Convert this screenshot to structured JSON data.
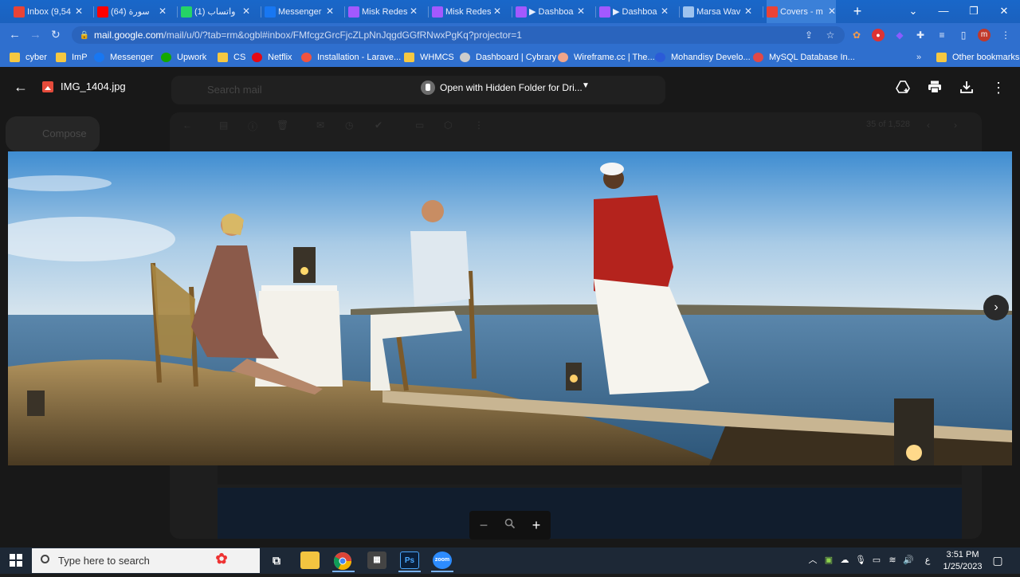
{
  "browser": {
    "tabs": [
      {
        "title": "Inbox (9,54",
        "icon": "gmail-icon",
        "color": "#ea4335"
      },
      {
        "title": "سورة (64)",
        "icon": "youtube-icon",
        "color": "#ff0000"
      },
      {
        "title": "(1) واتساب",
        "icon": "whatsapp-icon",
        "color": "#25d366"
      },
      {
        "title": "Messenger",
        "icon": "facebook-icon",
        "color": "#1877f2"
      },
      {
        "title": "Misk Redes",
        "icon": "figma-icon",
        "color": "#a259ff"
      },
      {
        "title": "Misk Redes",
        "icon": "figma-icon",
        "color": "#a259ff"
      },
      {
        "title": "▶ Dashboa",
        "icon": "figma-icon",
        "color": "#a259ff"
      },
      {
        "title": "▶ Dashboa",
        "icon": "figma-icon",
        "color": "#a259ff"
      },
      {
        "title": "Marsa Wav",
        "icon": "image-icon",
        "color": "#9ec3ef"
      },
      {
        "title": "Covers - m",
        "icon": "gmail-icon",
        "color": "#ea4335"
      }
    ],
    "active_tab_index": 9,
    "url_main": "mail.google.com",
    "url_rest": "/mail/u/0/?tab=rm&ogbl#inbox/FMfcgzGrcFjcZLpNnJqgdGGfRNwxPgKq?projector=1",
    "profile_letter": "m",
    "bookmarks": [
      {
        "label": "cyber",
        "icon": "folder-icon",
        "color": "#f5c842"
      },
      {
        "label": "ImP",
        "icon": "folder-icon",
        "color": "#f5c842"
      },
      {
        "label": "Messenger",
        "icon": "facebook-icon",
        "color": "#1877f2"
      },
      {
        "label": "Upwork",
        "icon": "upwork-icon",
        "color": "#14a800"
      },
      {
        "label": "CS",
        "icon": "folder-icon",
        "color": "#f5c842"
      },
      {
        "label": "Netflix",
        "icon": "netflix-icon",
        "color": "#e50914"
      },
      {
        "label": "Installation - Larave...",
        "icon": "laravel-icon",
        "color": "#f05340"
      },
      {
        "label": "WHMCS",
        "icon": "folder-icon",
        "color": "#f5c842"
      },
      {
        "label": "Dashboard | Cybrary",
        "icon": "cybrary-icon",
        "color": "#cccccc"
      },
      {
        "label": "Wireframe.cc | The...",
        "icon": "wireframe-icon",
        "color": "#f0a58a"
      },
      {
        "label": "Mohandisy Develo...",
        "icon": "mohandisy-icon",
        "color": "#2b5bd7"
      },
      {
        "label": "MySQL Database In...",
        "icon": "mysql-icon",
        "color": "#e04848"
      }
    ],
    "other_bookmarks": "Other bookmarks"
  },
  "gmail": {
    "compose": "Compose",
    "search_placeholder": "Search mail",
    "pager": "35 of 1,528"
  },
  "viewer": {
    "filename": "IMG_1404.jpg",
    "open_with": "Open with Hidden Folder for Dri...",
    "icons": [
      "add-to-drive-icon",
      "print-icon",
      "download-icon",
      "more-vert-icon"
    ],
    "zoom_controls": [
      "zoom-out-icon",
      "zoom-reset-icon",
      "zoom-in-icon"
    ]
  },
  "taskbar": {
    "search_placeholder": "Type here to search",
    "apps": [
      "task-view-icon",
      "file-explorer-icon",
      "chrome-icon",
      "media-icon",
      "photoshop-icon",
      "zoom-app-icon"
    ],
    "photoshop_label": "Ps",
    "zoom_label": "zoom",
    "lang": "ع",
    "time": "3:51 PM",
    "date": "1/25/2023"
  }
}
